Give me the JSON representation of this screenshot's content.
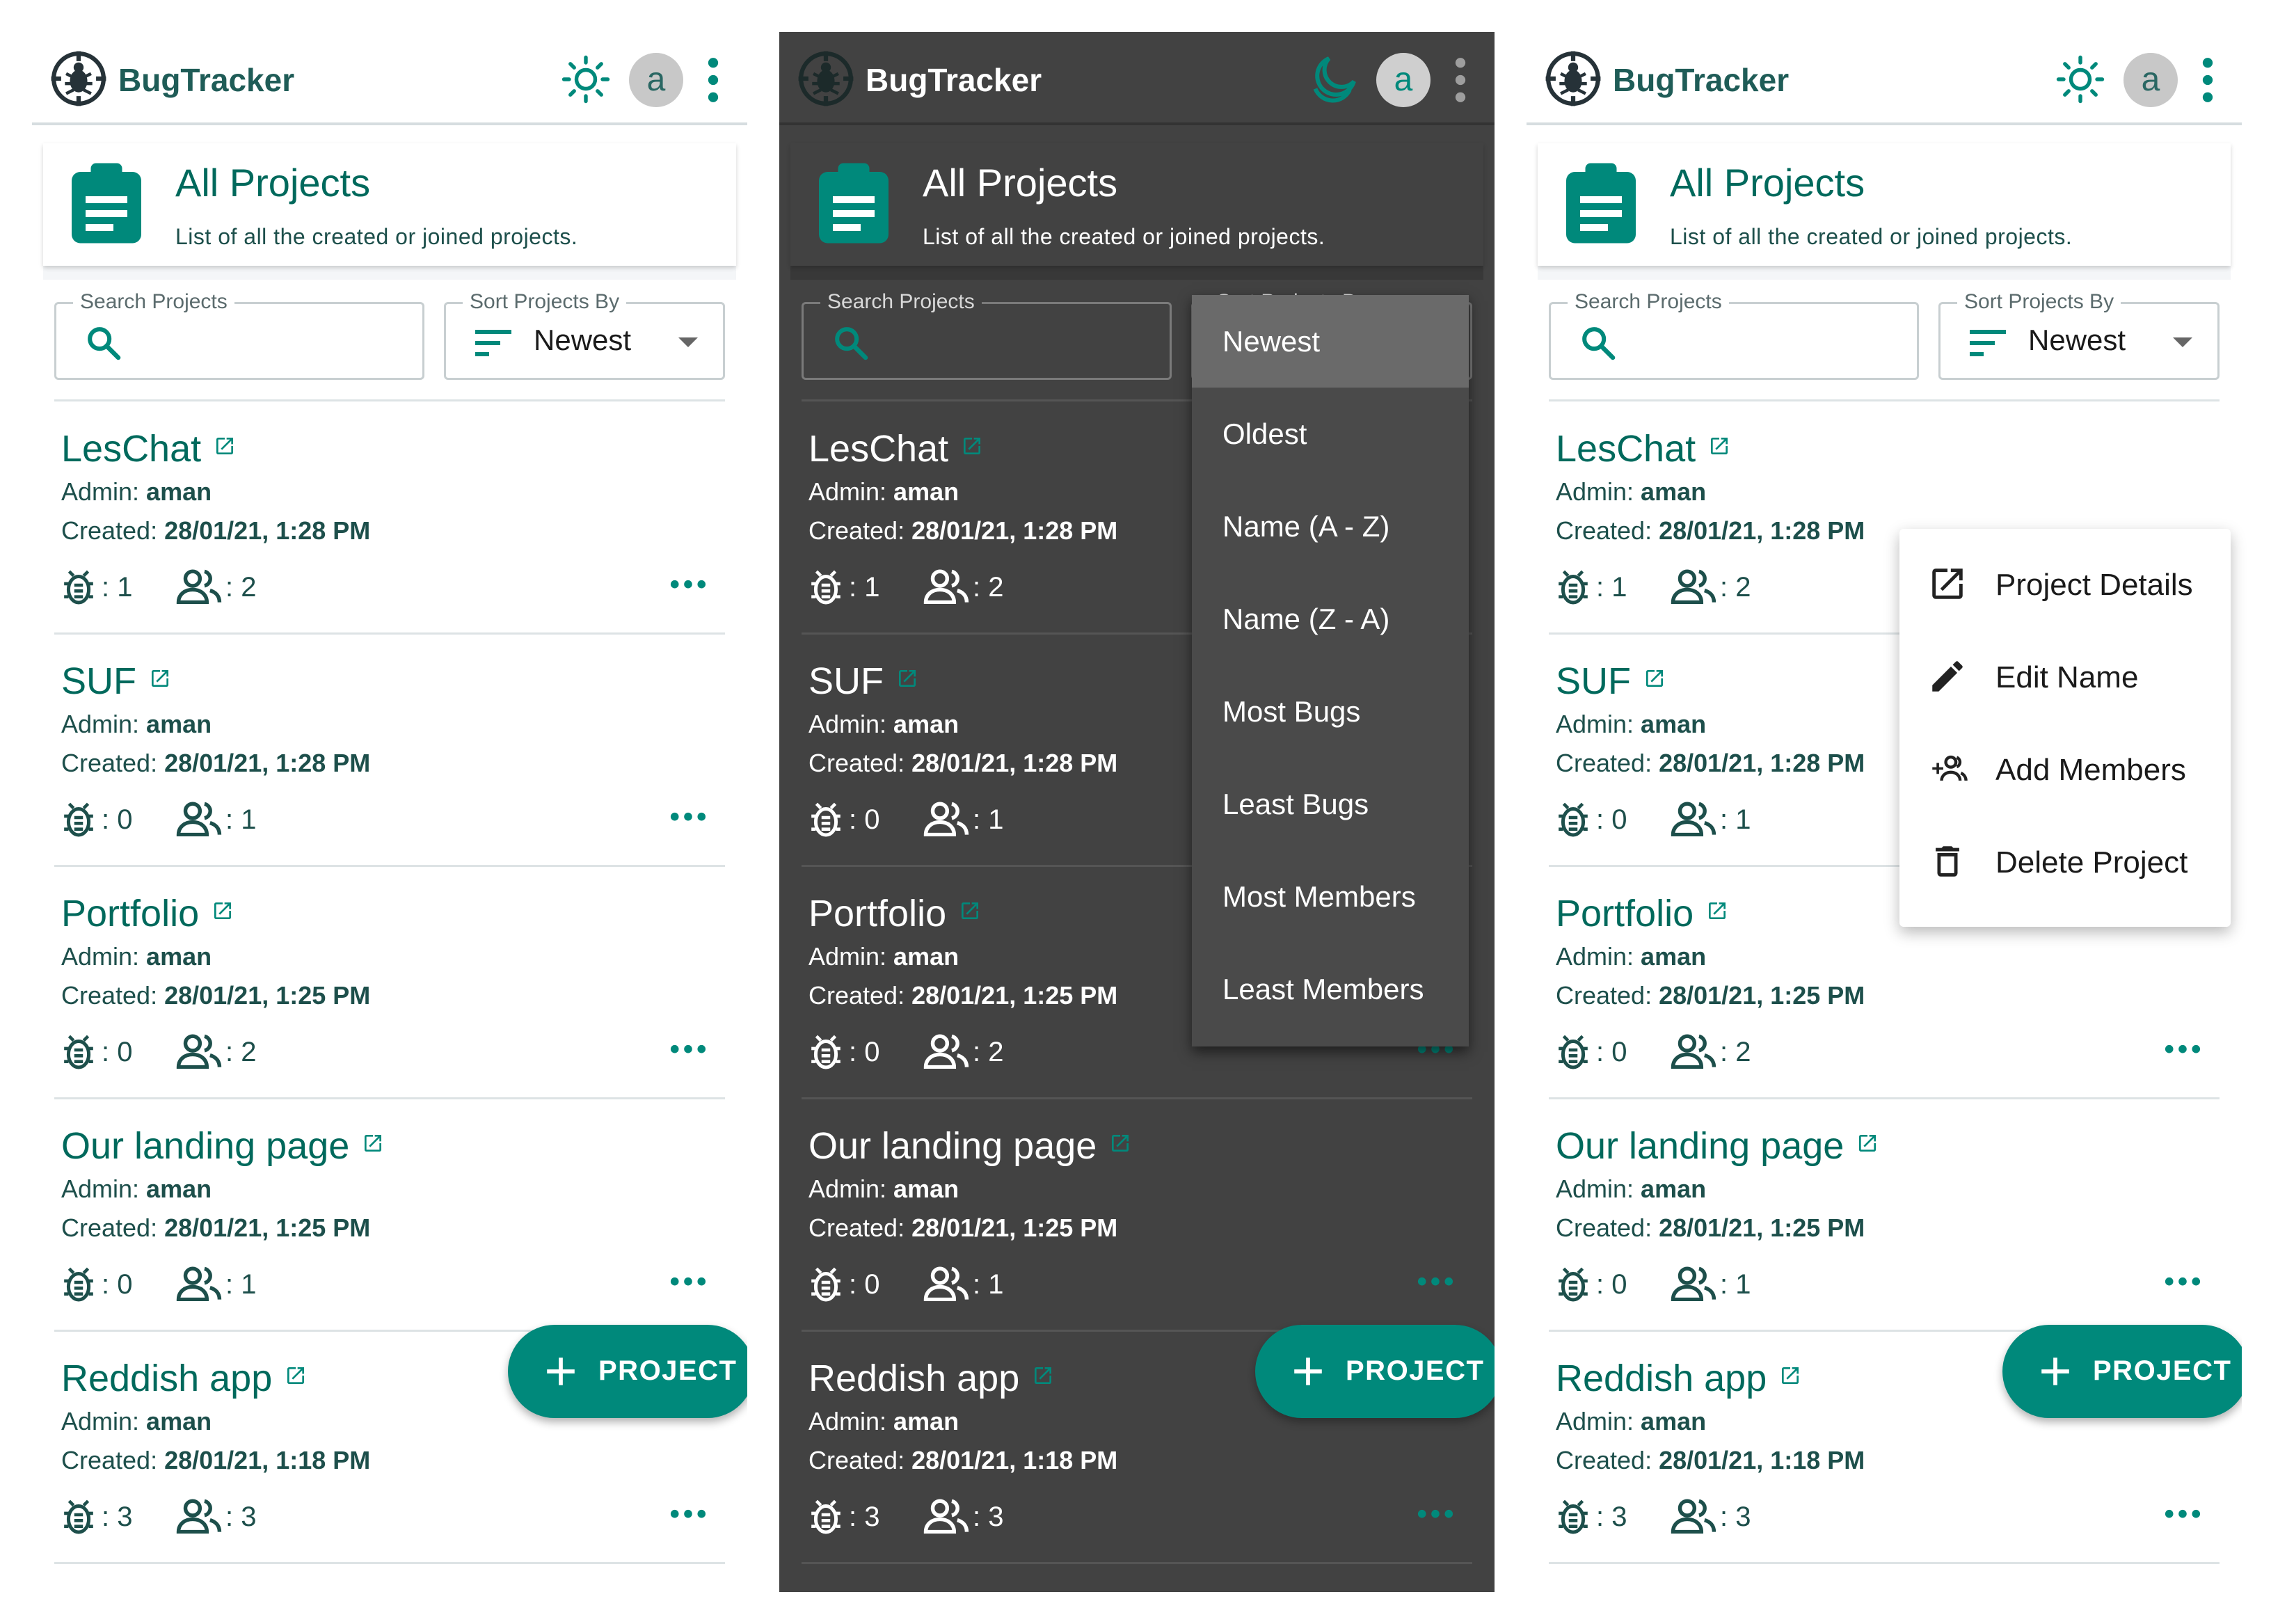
{
  "app": {
    "brand": "BugTracker",
    "avatar_initial": "a"
  },
  "colors": {
    "primary": "#00897b",
    "primary_dark": "#00695c",
    "text_dark_teal": "#1d4f4b",
    "dark_bg": "#424242",
    "light_bg": "#ffffff"
  },
  "icons": {
    "logo": "bug-logo-icon",
    "theme_light": "sun-icon",
    "theme_dark": "moon-icon",
    "menu": "more-vert-icon",
    "header": "clipboard-icon",
    "search": "search-icon",
    "sort": "sort-icon",
    "external": "open-in-new-icon",
    "bugs": "bug-icon",
    "members": "people-icon",
    "more": "more-horiz-icon",
    "add": "plus-icon"
  },
  "header": {
    "title": "All Projects",
    "subtitle": "List of all the created or joined projects."
  },
  "filters": {
    "search_label": "Search Projects",
    "search_value": "",
    "sort_label": "Sort Projects By",
    "sort_value": "Newest"
  },
  "labels": {
    "admin_prefix": "Admin: ",
    "created_prefix": "Created: "
  },
  "projects": [
    {
      "name": "LesChat",
      "admin": "aman",
      "created": "28/01/21, 1:28 PM",
      "bugs": ": 1",
      "members": ": 2"
    },
    {
      "name": "SUF",
      "admin": "aman",
      "created": "28/01/21, 1:28 PM",
      "bugs": ": 0",
      "members": ": 1"
    },
    {
      "name": "Portfolio",
      "admin": "aman",
      "created": "28/01/21, 1:25 PM",
      "bugs": ": 0",
      "members": ": 2"
    },
    {
      "name": "Our landing page",
      "admin": "aman",
      "created": "28/01/21, 1:25 PM",
      "bugs": ": 0",
      "members": ": 1"
    },
    {
      "name": "Reddish app",
      "admin": "aman",
      "created": "28/01/21, 1:18 PM",
      "bugs": ": 3",
      "members": ": 3"
    }
  ],
  "fab": {
    "label": "PROJECT"
  },
  "sort_menu": {
    "selected": "Newest",
    "options": [
      "Newest",
      "Oldest",
      "Name (A - Z)",
      "Name (Z - A)",
      "Most Bugs",
      "Least Bugs",
      "Most Members",
      "Least Members"
    ]
  },
  "context_menu": {
    "items": [
      {
        "label": "Project Details",
        "icon": "open-in-new-icon"
      },
      {
        "label": "Edit Name",
        "icon": "pencil-icon"
      },
      {
        "label": "Add Members",
        "icon": "group-add-icon"
      },
      {
        "label": "Delete Project",
        "icon": "trash-icon"
      }
    ]
  }
}
